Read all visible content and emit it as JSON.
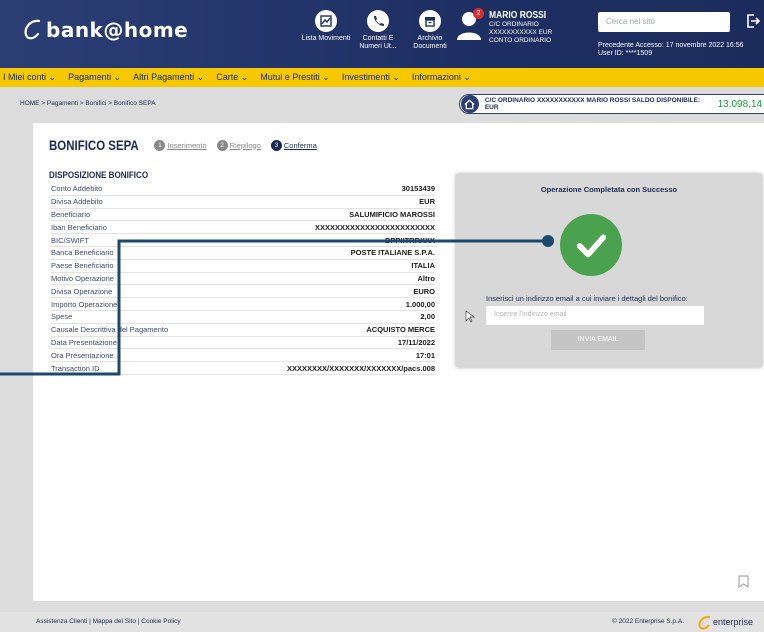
{
  "header": {
    "logo_text": "bank@home",
    "icons": [
      {
        "label": "Lista Movimenti",
        "icon": "chart-icon"
      },
      {
        "label": "Contatti E Numeri Ut...",
        "icon": "phone-icon"
      },
      {
        "label": "Archivio Documenti",
        "icon": "archive-icon"
      }
    ],
    "user": {
      "notification_count": "2",
      "name": "MARIO ROSSI",
      "account": "C/C ORDINARIO XXXXXXXXXXX EUR CONTO ORDINARIO"
    },
    "search_placeholder": "Cerca nel sito",
    "last_access": "Precedente Accesso: 17 novembre 2022 16:56",
    "user_id": "User ID: ****1509"
  },
  "nav": {
    "items": [
      "I Miei conti ⌄",
      "Pagamenti ⌄",
      "Altri Pagamenti ⌄",
      "Carte ⌄",
      "Mutui e Prestiti ⌄",
      "Investimenti ⌄",
      "Informazioni ⌄"
    ]
  },
  "breadcrumb": "HOME > Pagamenti > Bonifici > Bonifico SEPA",
  "account_bar": {
    "text": "C/C ORDINARIO XXXXXXXXXXX  MARIO ROSSI SALDO DISPONIBILE: EUR",
    "balance": "13.098,14",
    "info": "i"
  },
  "page": {
    "title": "BONIFICO SEPA",
    "steps": [
      {
        "num": "1",
        "label": "Inserimento"
      },
      {
        "num": "2",
        "label": "Riepilogo"
      },
      {
        "num": "3",
        "label": "Conferma"
      }
    ],
    "section_title": "DISPOSIZIONE BONIFICO"
  },
  "details": [
    {
      "label": "Conto Addebito",
      "value": "30153439"
    },
    {
      "label": "Divisa Addebito",
      "value": "EUR"
    },
    {
      "label": "Beneficiario",
      "value": "SALUMIFICIO MAROSSI"
    },
    {
      "label": "Iban Beneficiario",
      "value": "XXXXXXXXXXXXXXXXXXXXXXXX"
    },
    {
      "label": "BIC/SWIFT",
      "value": "BPPIITRRXXX"
    },
    {
      "label": "Banca Beneficiario",
      "value": "POSTE ITALIANE S.P.A."
    },
    {
      "label": "Paese Beneficiario",
      "value": "ITALIA"
    },
    {
      "label": "Motivo Operazione",
      "value": "Altro"
    },
    {
      "label": "Divisa Operazione",
      "value": "EURO"
    },
    {
      "label": "Importo Operazione",
      "value": "1.000,00"
    },
    {
      "label": "Spese",
      "value": "2,00"
    },
    {
      "label": "Causale Descrittiva del Pagamento",
      "value": "ACQUISTO MERCE"
    },
    {
      "label": "Data Presentazione",
      "value": "17/11/2022"
    },
    {
      "label": "Ora Presentazione",
      "value": "17:01"
    },
    {
      "label": "Transaction ID",
      "value": "XXXXXXXX/XXXXXXX/XXXXXXX/pacs.008"
    }
  ],
  "success": {
    "title": "Operazione Completata con Successo",
    "email_label": "Inserisci un indirizzo email a cui inviare i dettagli del bonifico:",
    "email_placeholder": "Inserire l'indirizzo email",
    "send_label": "INVIA EMAIL"
  },
  "footer": {
    "links": "Assistenza Clienti  |  Mappa del Sito  |  Cookie Policy",
    "copyright": "© 2022 Enterprise S.p.A.",
    "brand": "enterprise"
  },
  "colors": {
    "header_bg": "#1d2f63",
    "nav_bg": "#f6c800",
    "success_green": "#4aa24e",
    "balance_green": "#1a9e3a",
    "connector": "#1b4a6e"
  }
}
